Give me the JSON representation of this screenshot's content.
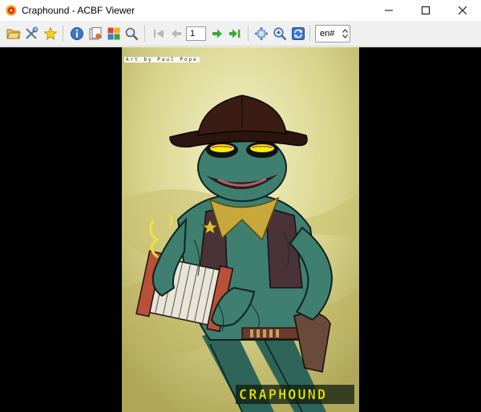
{
  "window": {
    "title": "Craphound - ACBF Viewer",
    "app_icon": "acbf-viewer-logo-icon",
    "controls": [
      "minimize-icon",
      "maximize-icon",
      "close-icon"
    ]
  },
  "toolbar": {
    "buttons": [
      "open-folder-icon",
      "settings-tools-icon",
      "bookmark-star-icon",
      "info-icon",
      "library-icon",
      "frames-icon",
      "search-magnifier-icon",
      "first-page-icon",
      "previous-page-icon",
      "next-page-icon",
      "last-page-icon",
      "fit-to-window-icon",
      "zoom-in-icon",
      "refresh-icon"
    ],
    "page_number": "1",
    "language": "en#"
  },
  "comic": {
    "credit": "Art by Paul Pope",
    "logo": "CRAPHOUND",
    "colors": {
      "background": "#e2e0a0",
      "frog_skin": "#3f7f6f",
      "hat": "#3b1c14",
      "goggles": "#f2f200",
      "accordion": "#b8503a"
    }
  }
}
